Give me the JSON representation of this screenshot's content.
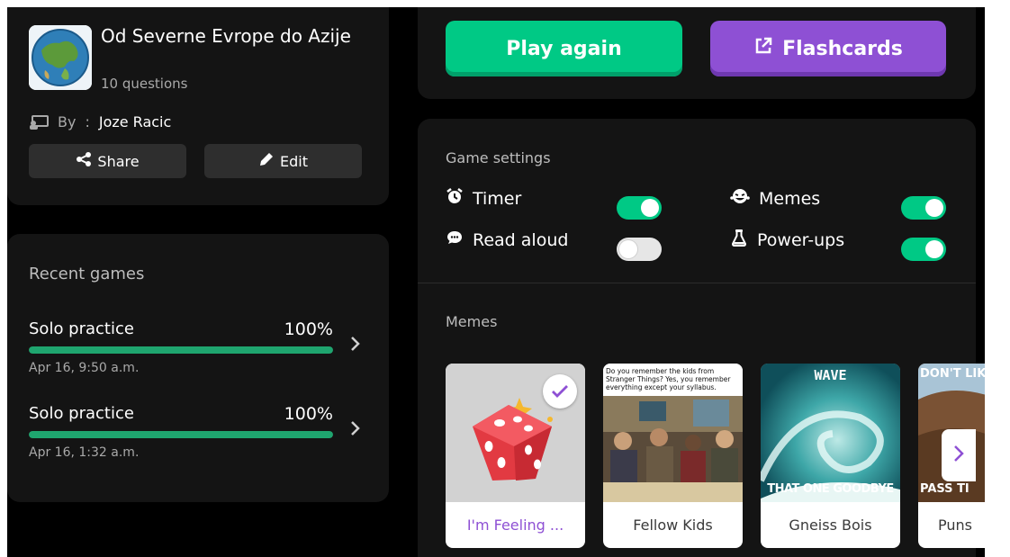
{
  "quiz": {
    "title": "Od Severne Evrope do Azije",
    "question_count": "10 questions",
    "by_label": "By",
    "by_separator": ":",
    "author": "Joze Racic",
    "share_label": "Share",
    "edit_label": "Edit"
  },
  "recent_games": {
    "title": "Recent games",
    "items": [
      {
        "name": "Solo practice",
        "score": "100%",
        "progress": 1.0,
        "date": "Apr 16, 9:50 a.m."
      },
      {
        "name": "Solo practice",
        "score": "100%",
        "progress": 1.0,
        "date": "Apr 16, 1:32 a.m."
      }
    ]
  },
  "actions": {
    "play_again_label": "Play again",
    "flashcards_label": "Flashcards"
  },
  "settings": {
    "title": "Game settings",
    "items": [
      {
        "label": "Timer",
        "icon": "alarm-clock-icon",
        "enabled": true
      },
      {
        "label": "Memes",
        "icon": "laughing-face-icon",
        "enabled": true
      },
      {
        "label": "Read aloud",
        "icon": "speech-bubble-icon",
        "enabled": false
      },
      {
        "label": "Power-ups",
        "icon": "flask-icon",
        "enabled": true
      }
    ]
  },
  "memes": {
    "title": "Memes",
    "items": [
      {
        "label": "I'm Feeling ...",
        "selected": true
      },
      {
        "label": "Fellow Kids",
        "selected": false,
        "caption": "Do you remember the kids from Stranger Things? Yes, you remember everything except your syllabus."
      },
      {
        "label": "Gneiss Bois",
        "selected": false,
        "top_text": "WAVE",
        "bottom_text": "THAT ONE GOODBYE"
      },
      {
        "label": "Puns",
        "selected": false,
        "top_text": "DON'T LIK",
        "bottom_text": "PASS TI"
      }
    ]
  },
  "colors": {
    "green": "#00c985",
    "purple": "#8e50d4",
    "progress": "#1fa56f",
    "card": "#141414"
  }
}
